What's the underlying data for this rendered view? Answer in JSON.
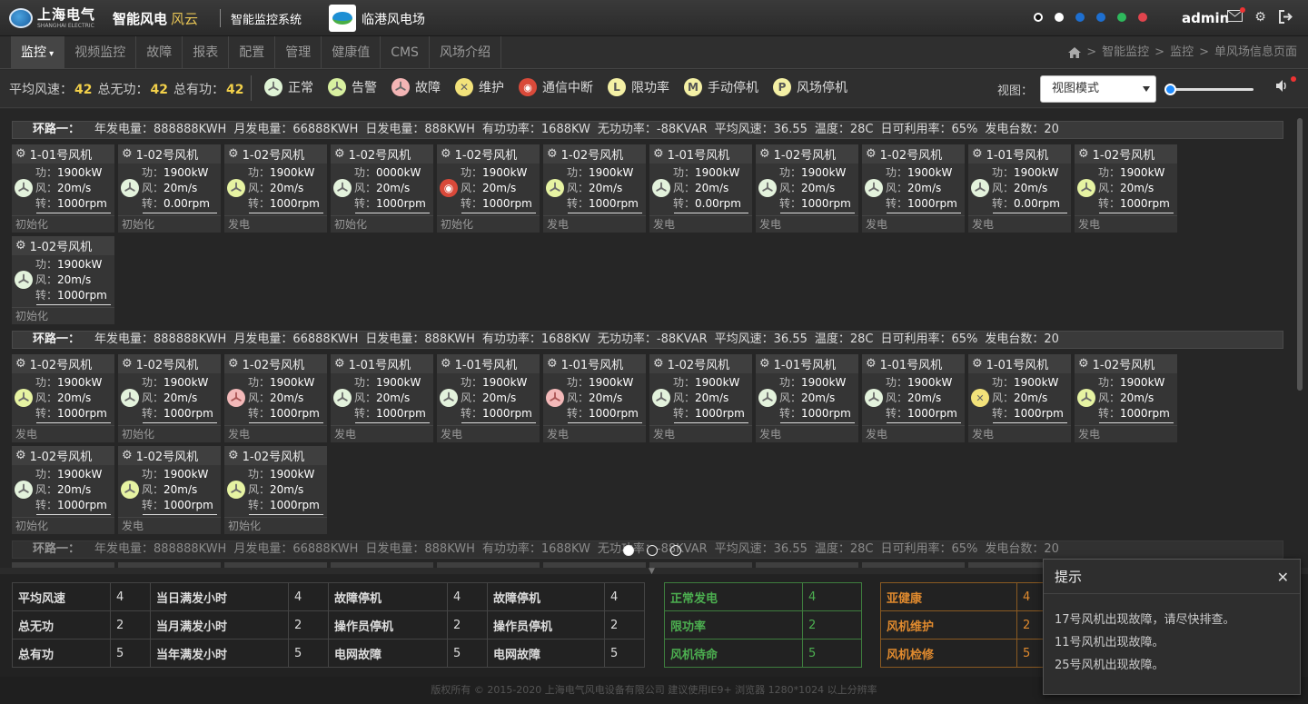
{
  "header": {
    "logo_cn": "上海电气",
    "logo_en": "SHANGHAI ELECTRIC",
    "product": "智能风电",
    "product_sub": "风云",
    "system": "智能监控系统",
    "site": "临港风电场",
    "status_dots": [
      "#ffffff",
      "#ffffff",
      "#1e6fd0",
      "#1e6fd0",
      "#2eb85c",
      "#e0444d"
    ],
    "user": "admin"
  },
  "nav": {
    "tabs": [
      "监控",
      "视频监控",
      "故障",
      "报表",
      "配置",
      "管理",
      "健康值",
      "CMS",
      "风场介绍"
    ],
    "active_index": 0,
    "breadcrumb": [
      "智能监控",
      "监控",
      "单风场信息页面"
    ]
  },
  "status": {
    "avg_wind_label": "平均风速：",
    "avg_wind": "42",
    "reactive_label": "总无功：",
    "reactive": "42",
    "active_label": "总有功：",
    "active": "42",
    "legend": [
      {
        "icon": "fan-icon",
        "label": "正常",
        "color": "#dff3d5"
      },
      {
        "icon": "fan-icon",
        "label": "告警",
        "color": "#d8f0a0"
      },
      {
        "icon": "fan-icon",
        "label": "故障",
        "color": "#f3b5b5"
      },
      {
        "icon": "wrench-icon",
        "label": "维护",
        "color": "#f2e27a"
      },
      {
        "icon": "signal-icon",
        "label": "通信中断",
        "color": "#d94a3a"
      },
      {
        "icon": "L",
        "label": "限功率",
        "color": "#f4f0a5"
      },
      {
        "icon": "M",
        "label": "手动停机",
        "color": "#f4f0a5"
      },
      {
        "icon": "P",
        "label": "风场停机",
        "color": "#f4f0a5"
      }
    ],
    "view_label": "视图：",
    "view_value": "视图模式",
    "zoom_level": 0.0
  },
  "loops": [
    {
      "name": "环路一：",
      "summary": [
        "年发电量：888888KWH",
        "月发电量：66888KWH",
        "日发电量：888KWH",
        "有功功率：1688KW",
        "无功功率：-88KVAR",
        "平均风速：36.55",
        "温度：28C",
        "日可利用率：65%",
        "发电台数：20"
      ],
      "turbines": [
        {
          "name": "1-01号风机",
          "power": "1900",
          "wind": "20",
          "speed": "1000",
          "state": "初始化",
          "status": "normal"
        },
        {
          "name": "1-02号风机",
          "power": "1900",
          "wind": "20",
          "speed": "0.00",
          "state": "初始化",
          "status": "normal"
        },
        {
          "name": "1-02号风机",
          "power": "1900",
          "wind": "20",
          "speed": "1000",
          "state": "发电",
          "status": "alarm"
        },
        {
          "name": "1-02号风机",
          "power": "0000",
          "wind": "20",
          "speed": "1000",
          "state": "初始化",
          "status": "normal"
        },
        {
          "name": "1-02号风机",
          "power": "1900",
          "wind": "20",
          "speed": "1000",
          "state": "初始化",
          "status": "comm"
        },
        {
          "name": "1-02号风机",
          "power": "1900",
          "wind": "20",
          "speed": "1000",
          "state": "发电",
          "status": "alarm"
        },
        {
          "name": "1-01号风机",
          "power": "1900",
          "wind": "20",
          "speed": "0.00",
          "state": "发电",
          "status": "normal"
        },
        {
          "name": "1-02号风机",
          "power": "1900",
          "wind": "20",
          "speed": "1000",
          "state": "发电",
          "status": "normal"
        },
        {
          "name": "1-02号风机",
          "power": "1900",
          "wind": "20",
          "speed": "1000",
          "state": "发电",
          "status": "normal"
        },
        {
          "name": "1-01号风机",
          "power": "1900",
          "wind": "20",
          "speed": "0.00",
          "state": "发电",
          "status": "normal"
        },
        {
          "name": "1-02号风机",
          "power": "1900",
          "wind": "20",
          "speed": "1000",
          "state": "发电",
          "status": "alarm"
        },
        {
          "name": "1-02号风机",
          "power": "1900",
          "wind": "20",
          "speed": "1000",
          "state": "初始化",
          "status": "normal"
        }
      ]
    },
    {
      "name": "环路一：",
      "summary": [
        "年发电量：888888KWH",
        "月发电量：66888KWH",
        "日发电量：888KWH",
        "有功功率：1688KW",
        "无功功率：-88KVAR",
        "平均风速：36.55",
        "温度：28C",
        "日可利用率：65%",
        "发电台数：20"
      ],
      "turbines": [
        {
          "name": "1-02号风机",
          "power": "1900",
          "wind": "20",
          "speed": "1000",
          "state": "发电",
          "status": "alarm"
        },
        {
          "name": "1-02号风机",
          "power": "1900",
          "wind": "20",
          "speed": "1000",
          "state": "初始化",
          "status": "normal"
        },
        {
          "name": "1-02号风机",
          "power": "1900",
          "wind": "20",
          "speed": "1000",
          "state": "发电",
          "status": "fault"
        },
        {
          "name": "1-01号风机",
          "power": "1900",
          "wind": "20",
          "speed": "1000",
          "state": "发电",
          "status": "normal"
        },
        {
          "name": "1-01号风机",
          "power": "1900",
          "wind": "20",
          "speed": "1000",
          "state": "发电",
          "status": "normal"
        },
        {
          "name": "1-01号风机",
          "power": "1900",
          "wind": "20",
          "speed": "1000",
          "state": "发电",
          "status": "fault"
        },
        {
          "name": "1-02号风机",
          "power": "1900",
          "wind": "20",
          "speed": "1000",
          "state": "发电",
          "status": "normal"
        },
        {
          "name": "1-01号风机",
          "power": "1900",
          "wind": "20",
          "speed": "1000",
          "state": "发电",
          "status": "normal"
        },
        {
          "name": "1-01号风机",
          "power": "1900",
          "wind": "20",
          "speed": "1000",
          "state": "发电",
          "status": "normal"
        },
        {
          "name": "1-01号风机",
          "power": "1900",
          "wind": "20",
          "speed": "1000",
          "state": "发电",
          "status": "maint"
        },
        {
          "name": "1-02号风机",
          "power": "1900",
          "wind": "20",
          "speed": "1000",
          "state": "发电",
          "status": "alarm"
        },
        {
          "name": "1-02号风机",
          "power": "1900",
          "wind": "20",
          "speed": "1000",
          "state": "初始化",
          "status": "normal"
        },
        {
          "name": "1-02号风机",
          "power": "1900",
          "wind": "20",
          "speed": "1000",
          "state": "发电",
          "status": "alarm"
        },
        {
          "name": "1-02号风机",
          "power": "1900",
          "wind": "20",
          "speed": "1000",
          "state": "初始化",
          "status": "alarm"
        }
      ]
    },
    {
      "name": "环路一：",
      "summary": [
        "年发电量：888888KWH",
        "月发电量：66888KWH",
        "日发电量：888KWH",
        "有功功率：1688KW",
        "无功功率：-88KVAR",
        "平均风速：36.55",
        "温度：28C",
        "日可利用率：65%",
        "发电台数：20"
      ]
    }
  ],
  "labels": {
    "power": "功：",
    "wind": "风：",
    "speed": "转：",
    "power_unit": "kW",
    "wind_unit": "m/s",
    "speed_unit": "rpm"
  },
  "summary_tables": {
    "t1": [
      [
        "平均风速",
        "4",
        "当日满发小时",
        "4",
        "故障停机",
        "4",
        "故障停机",
        "4"
      ],
      [
        "总无功",
        "2",
        "当月满发小时",
        "2",
        "操作员停机",
        "2",
        "操作员停机",
        "2"
      ],
      [
        "总有功",
        "5",
        "当年满发小时",
        "5",
        "电网故障",
        "5",
        "电网故障",
        "5"
      ]
    ],
    "t2": [
      [
        "正常发电",
        "4"
      ],
      [
        "限功率",
        "2"
      ],
      [
        "风机待命",
        "5"
      ]
    ],
    "t3": [
      [
        "亚健康",
        "4"
      ],
      [
        "风机维护",
        "2"
      ],
      [
        "风机检修",
        "5"
      ]
    ],
    "green": "#4caf50",
    "orange": "#e08a2e"
  },
  "popup": {
    "title": "提示",
    "messages": [
      "17号风机出现故障，请尽快排查。",
      "11号风机出现故障。",
      "25号风机出现故障。"
    ]
  },
  "footer": "版权所有 © 2015-2020 上海电气风电设备有限公司 建议使用IE9+ 浏览器 1280*1024 以上分辨率"
}
